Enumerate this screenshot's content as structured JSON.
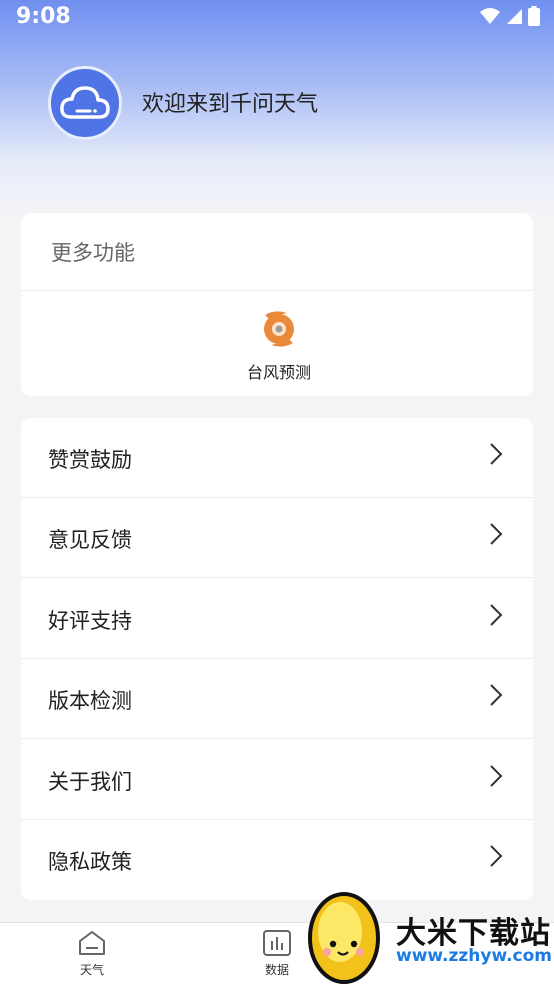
{
  "status_bar": {
    "time": "9:08"
  },
  "header": {
    "welcome_text": "欢迎来到千问天气"
  },
  "more_card": {
    "title": "更多功能",
    "features": [
      {
        "label": "台风预测",
        "icon": "typhoon-icon"
      }
    ]
  },
  "menu": {
    "items": [
      {
        "label": "赞赏鼓励"
      },
      {
        "label": "意见反馈"
      },
      {
        "label": "好评支持"
      },
      {
        "label": "版本检测"
      },
      {
        "label": "关于我们"
      },
      {
        "label": "隐私政策"
      }
    ]
  },
  "bottom_nav": {
    "items": [
      {
        "label": "天气",
        "icon": "home-icon"
      },
      {
        "label": "数据",
        "icon": "chart-icon"
      }
    ]
  },
  "watermark": {
    "title": "大米下载站",
    "url": "www.zzhyw.com"
  },
  "colors": {
    "accent": "#4e74e6",
    "typhoon": "#e98a3a"
  }
}
